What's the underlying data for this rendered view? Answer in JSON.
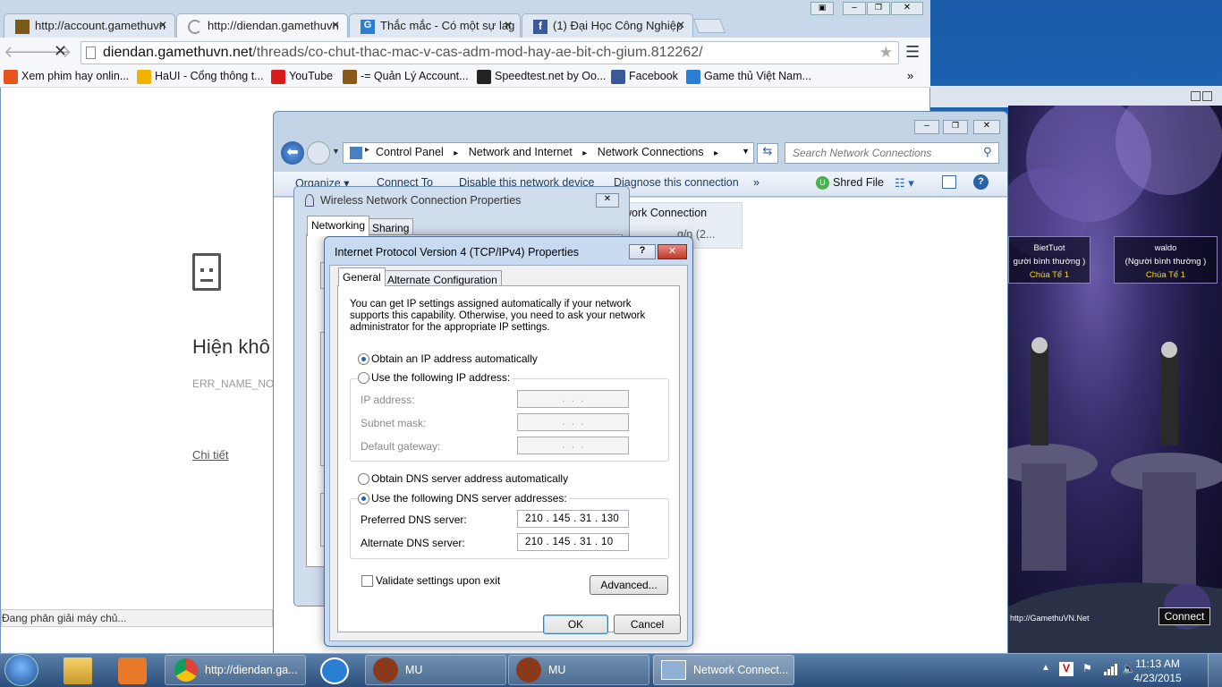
{
  "chrome": {
    "tabs": [
      {
        "label": "http://account.gamethuvn"
      },
      {
        "label": "http://diendan.gamethuvn"
      },
      {
        "label": "Thắc mắc - Có một sự lag"
      },
      {
        "label": "(1) Đại Học Công Nghiệp"
      }
    ],
    "url_domain": "diendan.gamethuvn.net",
    "url_path": "/threads/co-chut-thac-mac-v-cas-adm-mod-hay-ae-bit-ch-gium.812262/",
    "bookmarks": [
      {
        "label": "Xem phim hay onlin...",
        "color": "#e8541e"
      },
      {
        "label": "HaUI - Cổng thông t...",
        "color": "#f2b200"
      },
      {
        "label": "YouTube",
        "color": "#d91b1b"
      },
      {
        "label": "-= Quản Lý Account...",
        "color": "#8a5a1a"
      },
      {
        "label": "Speedtest.net by Oo...",
        "color": "#222222"
      },
      {
        "label": "Facebook",
        "color": "#3b5998"
      },
      {
        "label": "Game thủ Việt Nam...",
        "color": "#2a7fd4"
      }
    ],
    "error_title": "Hiện khô",
    "error_code": "ERR_NAME_NO",
    "details_link": "Chi tiết",
    "status": "Đang phân giải máy chủ..."
  },
  "explorer": {
    "breadcrumb": [
      "Control Panel",
      "Network and Internet",
      "Network Connections"
    ],
    "search_placeholder": "Search Network Connections",
    "commands": [
      "Organize ▾",
      "Connect To",
      "Disable this network device",
      "Diagnose this connection",
      "»"
    ],
    "shred_label": "Shred File",
    "item_name": "work Connection",
    "item_sub": "g/n (2..."
  },
  "wireless_props": {
    "title": "Wireless Network Connection Properties",
    "tabs": [
      "Networking",
      "Sharing"
    ]
  },
  "ipv4": {
    "title": "Internet Protocol Version 4 (TCP/IPv4) Properties",
    "tabs": [
      "General",
      "Alternate Configuration"
    ],
    "description": "You can get IP settings assigned automatically if your network supports this capability. Otherwise, you need to ask your network administrator for the appropriate IP settings.",
    "obtain_ip_auto": "Obtain an IP address automatically",
    "use_following_ip": "Use the following IP address:",
    "ip_address_label": "IP address:",
    "subnet_label": "Subnet mask:",
    "gateway_label": "Default gateway:",
    "empty_ip": " .  .  . ",
    "obtain_dns_auto": "Obtain DNS server address automatically",
    "use_following_dns": "Use the following DNS server addresses:",
    "preferred_dns_label": "Preferred DNS server:",
    "preferred_dns_value": "210 . 145 . 31 . 130",
    "alternate_dns_label": "Alternate DNS server:",
    "alternate_dns_value": "210 . 145 . 31 . 10",
    "validate_label": "Validate settings upon exit",
    "advanced_button": "Advanced...",
    "ok_button": "OK",
    "cancel_button": "Cancel"
  },
  "game": {
    "players": [
      {
        "name": "BietTuot",
        "status": "gười bình thường )",
        "rank": "Chúa Tể  1"
      },
      {
        "name": "waldo",
        "status": "(Người bình thường )",
        "rank": "Chúa Tể  1"
      }
    ],
    "url": "http://GamethuVN.Net",
    "connect": "Connect"
  },
  "taskbar": {
    "items": [
      "http://diendan.ga...",
      "MU",
      "MU",
      "Network Connect..."
    ],
    "time": "11:13 AM",
    "date": "4/23/2015"
  },
  "colors": {
    "accent": "#3c7fb1",
    "radio": "#1e63b8",
    "taskbar": "#2b4f7a"
  }
}
